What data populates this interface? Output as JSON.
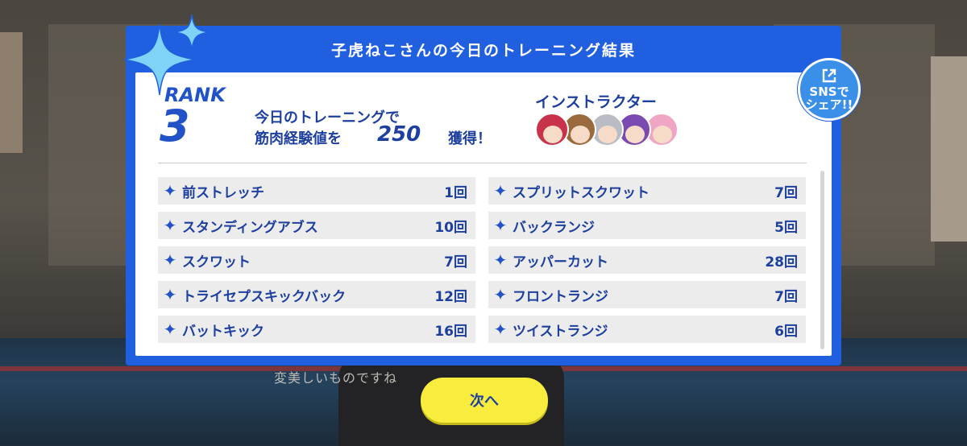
{
  "background": {
    "subtitle": "変美しいものですね"
  },
  "dialog": {
    "title": "子虎ねこさんの今日のトレーニング結果",
    "rank_label": "RANK",
    "rank_value": "3",
    "gain_line1": "今日のトレーニングで",
    "gain_line2": "筋肉経験値を",
    "gain_amount": "250",
    "gain_suffix": "獲得！",
    "instructor_label": "インストラクター",
    "instructors": [
      {
        "name": "instructor-red-hair",
        "hair": "#c8324b"
      },
      {
        "name": "instructor-brown-hair",
        "hair": "#9a6a3c"
      },
      {
        "name": "instructor-silver-hair",
        "hair": "#b9bcc4"
      },
      {
        "name": "instructor-purple-hair",
        "hair": "#7b4ab0"
      },
      {
        "name": "instructor-pink-hair",
        "hair": "#f0a5c4"
      }
    ],
    "exercises_left": [
      {
        "name": "前ストレッチ",
        "count": "1回"
      },
      {
        "name": "スタンディングアブス",
        "count": "10回"
      },
      {
        "name": "スクワット",
        "count": "7回"
      },
      {
        "name": "トライセプスキックバック",
        "count": "12回"
      },
      {
        "name": "バットキック",
        "count": "16回"
      }
    ],
    "exercises_right": [
      {
        "name": "スプリットスクワット",
        "count": "7回"
      },
      {
        "name": "バックランジ",
        "count": "5回"
      },
      {
        "name": "アッパーカット",
        "count": "28回"
      },
      {
        "name": "フロントランジ",
        "count": "7回"
      },
      {
        "name": "ツイストランジ",
        "count": "6回"
      }
    ],
    "list_marker": "✦"
  },
  "sns_button": {
    "line1": "SNSで",
    "line2": "シェア!!",
    "icon": "external-link-icon"
  },
  "next_button": {
    "label": "次へ"
  },
  "colors": {
    "accent_blue": "#2060e0",
    "text_blue": "#1d3f9e",
    "next_yellow": "#f8ec3c"
  }
}
